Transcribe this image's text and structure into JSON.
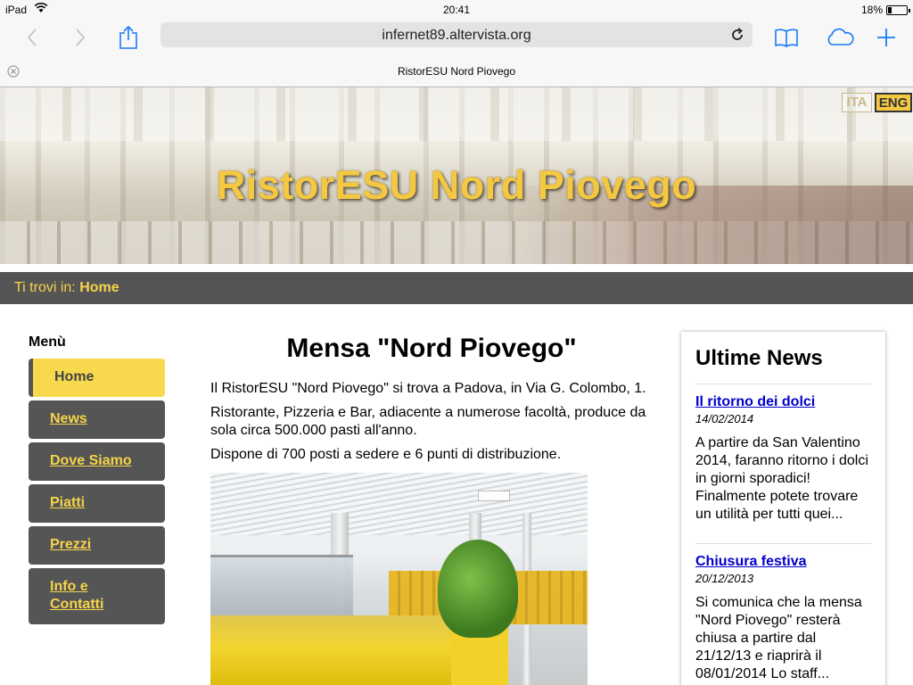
{
  "status_bar": {
    "device": "iPad",
    "time": "20:41",
    "battery": "18%",
    "battery_level": 0.18
  },
  "browser": {
    "url": "infernet89.altervista.org",
    "tab_title": "RistorESU Nord Piovego",
    "icons": [
      "back-icon",
      "forward-icon",
      "share-icon",
      "reload-icon",
      "bookmarks-icon",
      "icloud-tabs-icon",
      "new-tab-icon",
      "close-tab-icon"
    ]
  },
  "site": {
    "title": "RistorESU Nord Piovego",
    "lang_ita": "ITA",
    "lang_eng": "ENG",
    "breadcrumb_prefix": "Ti trovi in:",
    "breadcrumb_current": "Home"
  },
  "menu": {
    "title": "Menù",
    "items": [
      {
        "label": "Home"
      },
      {
        "label": "News"
      },
      {
        "label": "Dove Siamo"
      },
      {
        "label": "Piatti"
      },
      {
        "label": "Prezzi"
      },
      {
        "label": "Info e Contatti"
      }
    ]
  },
  "main": {
    "heading": "Mensa \"Nord Piovego\"",
    "paragraphs": [
      "Il RistorESU \"Nord Piovego\" si trova a Padova, in Via G. Colombo, 1.",
      "Ristorante, Pizzeria e Bar, adiacente a numerose facoltà, produce da sola circa 500.000 pasti all'anno.",
      "Dispone di 700 posti a sedere e 6 punti di distribuzione."
    ]
  },
  "news": {
    "heading": "Ultime News",
    "items": [
      {
        "title": "Il ritorno dei dolci",
        "date": "14/02/2014",
        "body": "A partire da San Valentino 2014, faranno ritorno i dolci in giorni sporadici! Finalmente potete trovare un utilità per tutti quei..."
      },
      {
        "title": "Chiusura festiva",
        "date": "20/12/2013",
        "body": "Si comunica che la mensa \"Nord Piovego\" resterà chiusa a partire dal 21/12/13 e riaprirà il 08/01/2014 Lo staff..."
      }
    ]
  },
  "colors": {
    "accent_yellow": "#f5d44a",
    "dark_gray": "#555555",
    "link_blue": "#0000cc"
  }
}
